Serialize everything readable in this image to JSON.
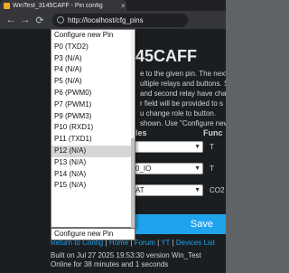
{
  "browser": {
    "tab_title": "WinTest_3145CAFF - Pin config",
    "close": "×",
    "back": "←",
    "forward": "→",
    "reload": "⟳",
    "url": "http://localhost/cfg_pins"
  },
  "page": {
    "device_title": "45CAFF",
    "info": [
      "e to the given pin. The next",
      "ultiple relays and buttons. S",
      "and second relay have chan",
      "r field will be provided to s",
      "u change role to button.",
      "shown. Use \"Configure new"
    ],
    "col_headers": [
      "les",
      "Func"
    ],
    "rows": [
      {
        "value": "",
        "side": "T"
      },
      {
        "value": "0_IO",
        "side": "T"
      },
      {
        "value": "AT",
        "side": "CO2"
      }
    ],
    "save_label": "Save",
    "links": [
      "Return to Config",
      "Home",
      "Forum",
      "YT",
      "Devices List"
    ],
    "footer": [
      "Built on Jul 27 2025 19:53:30 version Win_Test",
      "Online for 38 minutes and 1 seconds"
    ]
  },
  "dropdown": {
    "items": [
      "Configure new Pin",
      "P0 (TXD2)",
      "P3 (N/A)",
      "P4 (N/A)",
      "P5 (N/A)",
      "P6 (PWM0)",
      "P7 (PWM1)",
      "P9 (PWM3)",
      "P10 (RXD1)",
      "P11 (TXD1)",
      "P12 (N/A)",
      "P13 (N/A)",
      "P14 (N/A)",
      "P15 (N/A)"
    ],
    "hovered_index": 10,
    "selected_value": "Configure new Pin"
  }
}
